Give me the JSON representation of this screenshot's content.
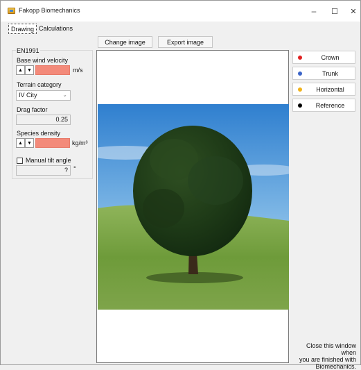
{
  "window": {
    "title": "Fakopp Biomechanics",
    "minimize_glyph": "–",
    "maximize_glyph": "☐",
    "close_glyph": "✕"
  },
  "tabs": [
    {
      "label": "Drawing",
      "active": true
    },
    {
      "label": "Calculations",
      "active": false
    }
  ],
  "toolbar": {
    "change_image": "Change image",
    "export_image": "Export image"
  },
  "left_panel": {
    "title": "EN1991",
    "base_wind_velocity": {
      "label": "Base wind velocity",
      "value": "",
      "unit": "m/s"
    },
    "terrain_category": {
      "label": "Terrain category",
      "value": "IV City"
    },
    "drag_factor": {
      "label": "Drag factor",
      "value": "0.25"
    },
    "species_density": {
      "label": "Species density",
      "value": "",
      "unit": "kg/m³"
    },
    "manual_tilt": {
      "label": "Manual tilt angle",
      "checked": false,
      "value": "?",
      "unit": "°"
    },
    "spin_up": "▲",
    "spin_down": "▼",
    "dropdown_glyph": "⌄",
    "error_color": "#f38a7a"
  },
  "markers": [
    {
      "label": "Crown",
      "color": "#e02020"
    },
    {
      "label": "Trunk",
      "color": "#3b64c8"
    },
    {
      "label": "Horizontal",
      "color": "#f0b21a"
    },
    {
      "label": "Reference",
      "color": "#000000"
    }
  ],
  "close_note": {
    "line1": "Close this window when",
    "line2": "you are finished with",
    "line3": "Biomechanics."
  },
  "icons": {
    "app": "app-icon",
    "spin_up": "arrow-up-icon",
    "spin_down": "arrow-down-icon",
    "dropdown": "chevron-down-icon"
  }
}
